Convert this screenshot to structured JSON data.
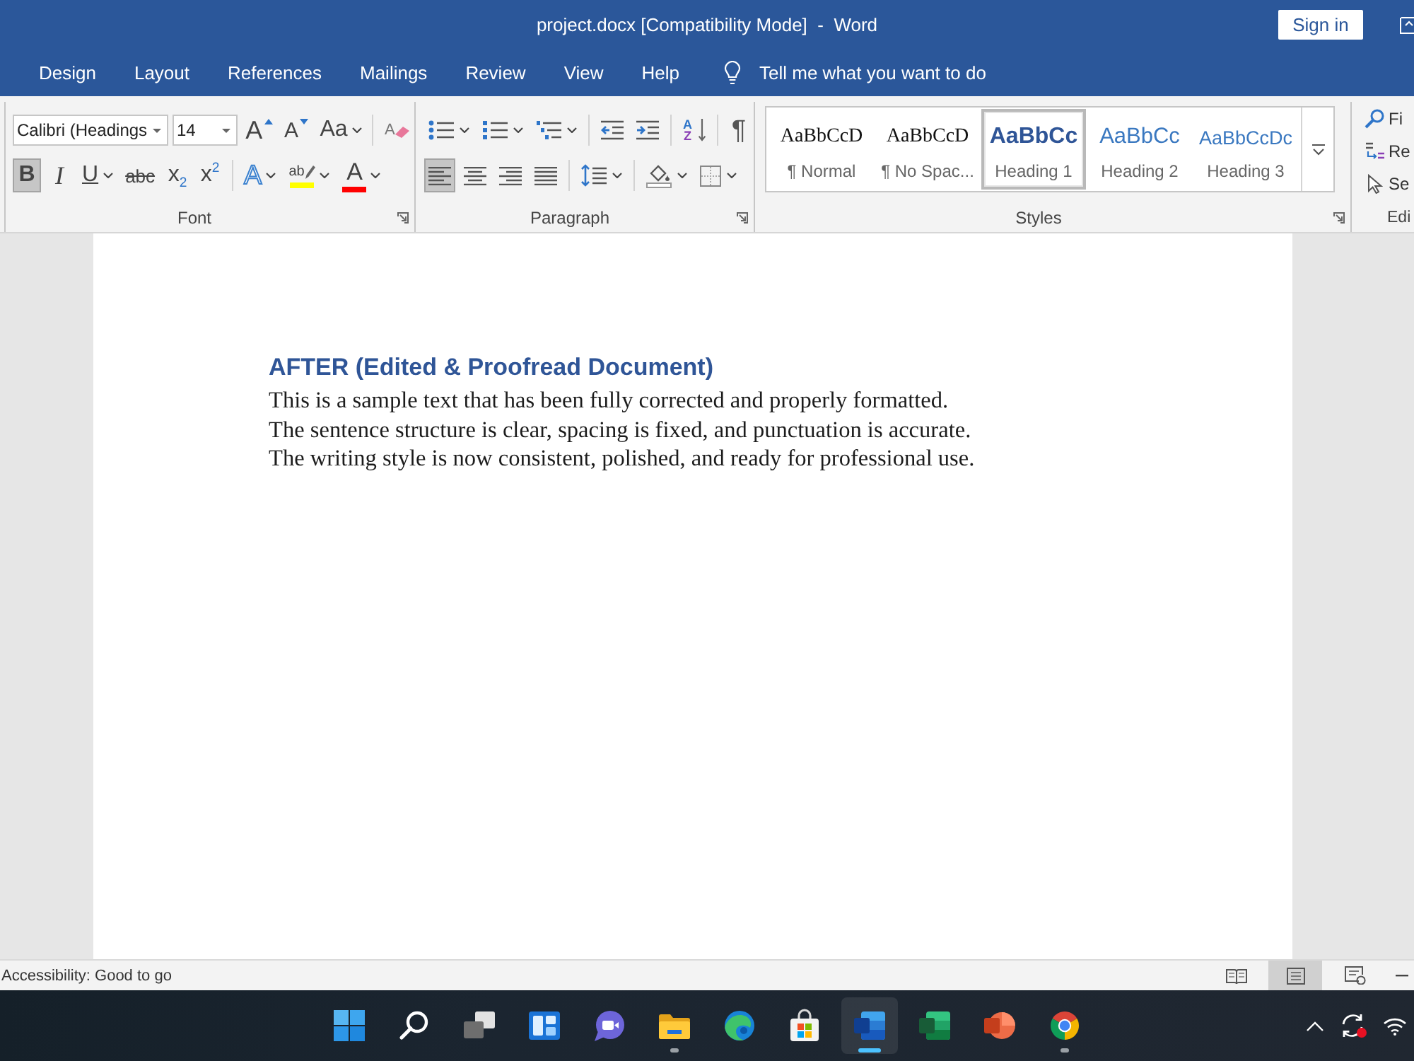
{
  "window": {
    "title": "project.docx [Compatibility Mode]  -  Word",
    "sign_in": "Sign in"
  },
  "ribbon_tabs": [
    {
      "label": "Design",
      "selected": false
    },
    {
      "label": "Layout",
      "selected": false
    },
    {
      "label": "References",
      "selected": false
    },
    {
      "label": "Mailings",
      "selected": false
    },
    {
      "label": "Review",
      "selected": false
    },
    {
      "label": "View",
      "selected": false
    },
    {
      "label": "Help",
      "selected": false
    }
  ],
  "tell_me": {
    "placeholder": "Tell me what you want to do"
  },
  "font_group": {
    "label": "Font",
    "launcher": true,
    "font_name": "Calibri (Headings",
    "font_size": "14",
    "top_row": [
      {
        "kind": "grow",
        "label": "A",
        "selected": false,
        "dropdown": false
      },
      {
        "kind": "shrink",
        "label": "A",
        "selected": false,
        "dropdown": false
      },
      {
        "kind": "case",
        "label": "Aa",
        "selected": false,
        "dropdown": true
      },
      {
        "kind": "clear",
        "label": "A",
        "selected": false,
        "dropdown": false
      }
    ],
    "bottom_row": [
      {
        "kind": "bold",
        "label": "B",
        "selected": true,
        "dropdown": false
      },
      {
        "kind": "italic",
        "label": "I",
        "selected": false,
        "dropdown": false
      },
      {
        "kind": "underline",
        "label": "U",
        "selected": false,
        "dropdown": true
      },
      {
        "kind": "strikethrough",
        "label": "abc",
        "selected": false,
        "dropdown": false
      },
      {
        "kind": "subscript",
        "label": "x$_{2}$",
        "selected": false,
        "dropdown": false
      },
      {
        "kind": "superscript",
        "label": "x$^{2}$",
        "selected": false,
        "dropdown": false
      },
      {
        "kind": "effects",
        "label": "A",
        "selected": false,
        "dropdown": true
      },
      {
        "kind": "highlight",
        "label": "ab",
        "color": "#ffff00",
        "selected": false,
        "dropdown": true
      },
      {
        "kind": "font_color",
        "label": "A",
        "color": "#ff0000",
        "selected": false,
        "dropdown": true
      }
    ]
  },
  "paragraph_group": {
    "label": "Paragraph",
    "launcher": true,
    "top_row": [
      {
        "kind": "bullets",
        "selected": false,
        "dropdown": true
      },
      {
        "kind": "numbering",
        "selected": false,
        "dropdown": true
      },
      {
        "kind": "multilevel",
        "selected": false,
        "dropdown": true
      },
      {
        "kind": "decrease_indent",
        "selected": false,
        "dropdown": false
      },
      {
        "kind": "increase_indent",
        "selected": false,
        "dropdown": false
      },
      {
        "kind": "sort",
        "label": "A",
        "label_2": "Z",
        "selected": false,
        "dropdown": false
      },
      {
        "kind": "show_marks",
        "label": "¶",
        "selected": false,
        "dropdown": false
      }
    ],
    "bottom_row": [
      {
        "kind": "align_left",
        "selected": true,
        "dropdown": false
      },
      {
        "kind": "align_center",
        "selected": false,
        "dropdown": false
      },
      {
        "kind": "align_right",
        "selected": false,
        "dropdown": false
      },
      {
        "kind": "justify",
        "selected": false,
        "dropdown": false
      },
      {
        "kind": "line_spacing",
        "selected": false,
        "dropdown": true
      },
      {
        "kind": "shading",
        "selected": false,
        "dropdown": true
      },
      {
        "kind": "borders",
        "selected": false,
        "dropdown": true
      }
    ]
  },
  "styles_group": {
    "label": "Styles",
    "launcher": true,
    "items": [
      {
        "kind": "normal",
        "preview": "AaBbCcD",
        "name": "¶ Normal",
        "selected": false
      },
      {
        "kind": "no_spacing",
        "preview": "AaBbCcD",
        "name": "¶ No Spac...",
        "selected": false
      },
      {
        "kind": "heading_1",
        "preview": "AaBbCc",
        "name": "Heading 1",
        "selected": true
      },
      {
        "kind": "heading_2",
        "preview": "AaBbCc",
        "name": "Heading 2",
        "selected": false
      },
      {
        "kind": "heading_3",
        "preview": "AaBbCcDc",
        "name": "Heading 3",
        "selected": false
      }
    ]
  },
  "editing_group": {
    "label": "Edi",
    "items": [
      {
        "kind": "find",
        "label": "Fi"
      },
      {
        "kind": "replace",
        "label": "Re"
      },
      {
        "kind": "select",
        "label": "Se"
      }
    ]
  },
  "document": {
    "heading": "AFTER (Edited & Proofread Document)",
    "paragraphs": [
      "This is a sample text that has been fully corrected and properly formatted.",
      "The sentence structure is clear, spacing is fixed, and punctuation is accurate.",
      "The writing style is now consistent, polished, and ready for professional use."
    ]
  },
  "status_bar": {
    "accessibility": "Accessibility: Good to go",
    "views": [
      {
        "kind": "read_mode",
        "selected": false
      },
      {
        "kind": "print_layout",
        "selected": true
      },
      {
        "kind": "web_layout",
        "selected": false
      }
    ]
  },
  "taskbar": {
    "apps": [
      {
        "kind": "start",
        "running": false,
        "active": false
      },
      {
        "kind": "search",
        "running": false,
        "active": false
      },
      {
        "kind": "task_view",
        "running": false,
        "active": false
      },
      {
        "kind": "widgets",
        "running": false,
        "active": false
      },
      {
        "kind": "chat",
        "running": false,
        "active": false
      },
      {
        "kind": "files",
        "running": true,
        "active": false
      },
      {
        "kind": "swirl_browser",
        "running": false,
        "active": false
      },
      {
        "kind": "store",
        "running": false,
        "active": false
      },
      {
        "kind": "documents",
        "running": true,
        "active": true
      },
      {
        "kind": "spreadsheets",
        "running": false,
        "active": false
      },
      {
        "kind": "presentations",
        "running": false,
        "active": false
      },
      {
        "kind": "circle_browser",
        "running": true,
        "active": false
      }
    ]
  }
}
